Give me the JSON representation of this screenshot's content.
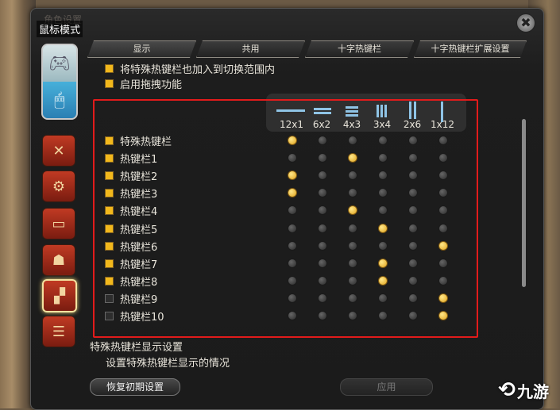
{
  "window": {
    "title": "鼠标模式",
    "faded_title": "角色设置"
  },
  "tabs": [
    {
      "label": "显示"
    },
    {
      "label": "共用"
    },
    {
      "label": "十字热键栏"
    },
    {
      "label": "十字热键栏扩展设置"
    }
  ],
  "options": [
    {
      "label": "将特殊热键栏也加入到切换范围内",
      "checked": true
    },
    {
      "label": "启用拖拽功能",
      "checked": true
    }
  ],
  "columns": [
    "12x1",
    "6x2",
    "4x3",
    "3x4",
    "2x6",
    "1x12"
  ],
  "rows": [
    {
      "label": "特殊热键栏",
      "enabled": true,
      "selected": 0
    },
    {
      "label": "热键栏1",
      "enabled": true,
      "selected": 2
    },
    {
      "label": "热键栏2",
      "enabled": true,
      "selected": 0
    },
    {
      "label": "热键栏3",
      "enabled": true,
      "selected": 0
    },
    {
      "label": "热键栏4",
      "enabled": true,
      "selected": 2
    },
    {
      "label": "热键栏5",
      "enabled": true,
      "selected": 3
    },
    {
      "label": "热键栏6",
      "enabled": true,
      "selected": 5
    },
    {
      "label": "热键栏7",
      "enabled": true,
      "selected": 3
    },
    {
      "label": "热键栏8",
      "enabled": true,
      "selected": 3
    },
    {
      "label": "热键栏9",
      "enabled": false,
      "selected": 5
    },
    {
      "label": "热键栏10",
      "enabled": false,
      "selected": 5
    }
  ],
  "description": {
    "title": "特殊热键栏显示设置",
    "text": "设置特殊热键栏显示的情况"
  },
  "buttons": {
    "reset": "恢复初期设置",
    "apply": "应用"
  },
  "watermark": {
    "text": "九游"
  },
  "icons": [
    "gamepad-icon",
    "mouse-icon",
    "battle-icon",
    "gear-icon",
    "card-icon",
    "character-icon",
    "hotbar-icon",
    "chat-icon",
    "close-icon"
  ],
  "colors": {
    "accent": "#f2b81c",
    "highlight": "#e21b1b"
  }
}
